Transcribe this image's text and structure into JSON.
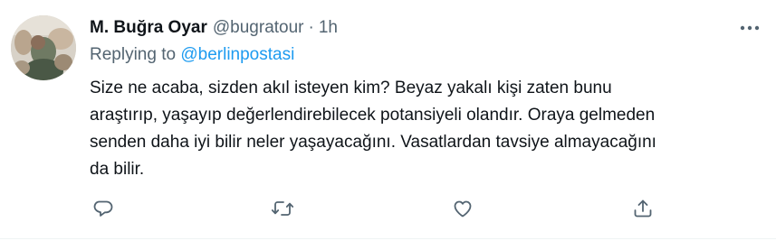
{
  "tweet": {
    "display_name": "M. Buğra Oyar",
    "handle": "@bugratour",
    "separator": "·",
    "time": "1h",
    "replying_prefix": "Replying to",
    "replying_to": "@berlinpostasi",
    "lines": [
      "Size ne acaba, sizden akıl isteyen kim? Beyaz yakalı kişi zaten bunu",
      "araştırıp, yaşayıp değerlendirebilecek potansiyeli olandır. Oraya gelmeden",
      "senden daha iyi bilir neler yaşayacağını. Vasatlardan tavsiye almayacağını",
      "da bilir."
    ]
  },
  "actions": {
    "reply_icon": "reply-icon",
    "retweet_icon": "retweet-icon",
    "like_icon": "heart-icon",
    "share_icon": "share-icon"
  },
  "colors": {
    "text": "#0f1419",
    "secondary": "#536471",
    "link": "#1d9bf0",
    "divider": "#eff3f4"
  }
}
